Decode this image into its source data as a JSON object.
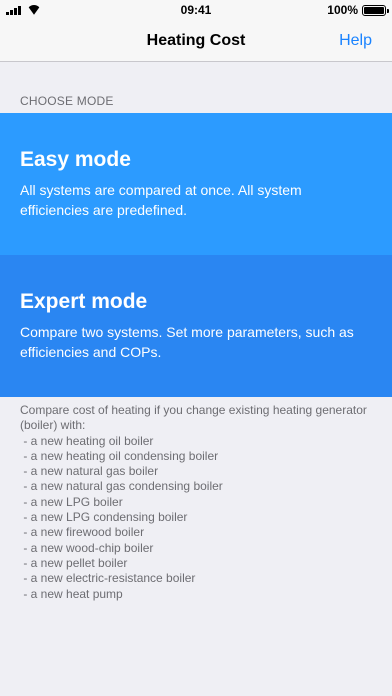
{
  "status_bar": {
    "time": "09:41",
    "battery": "100%",
    "signal_icon": "cellular-signal-icon",
    "wifi_icon": "wifi-icon",
    "battery_icon": "battery-icon"
  },
  "nav": {
    "title": "Heating Cost",
    "help_label": "Help"
  },
  "section_header": "CHOOSE MODE",
  "modes": [
    {
      "title": "Easy mode",
      "description": "All systems are compared at once. All system efficiencies are predefined.",
      "color": "#2c9bff"
    },
    {
      "title": "Expert mode",
      "description": "Compare two systems. Set more parameters, such as efficiencies and COPs.",
      "color": "#2a86f2"
    }
  ],
  "footer": {
    "intro": "Compare cost of heating if you change existing heating generator (boiler) with:",
    "items": [
      " - a new heating oil boiler",
      " - a new heating oil condensing boiler",
      " - a new natural gas boiler",
      " - a new natural gas condensing boiler",
      " - a new LPG boiler",
      " - a new LPG condensing boiler",
      " - a new firewood boiler",
      " - a new wood-chip boiler",
      " - a new pellet boiler",
      " - a new electric-resistance boiler",
      " - a new heat pump"
    ]
  },
  "colors": {
    "accent": "#1a83ff",
    "background": "#efeff4",
    "secondary_text": "#6d6d72"
  }
}
